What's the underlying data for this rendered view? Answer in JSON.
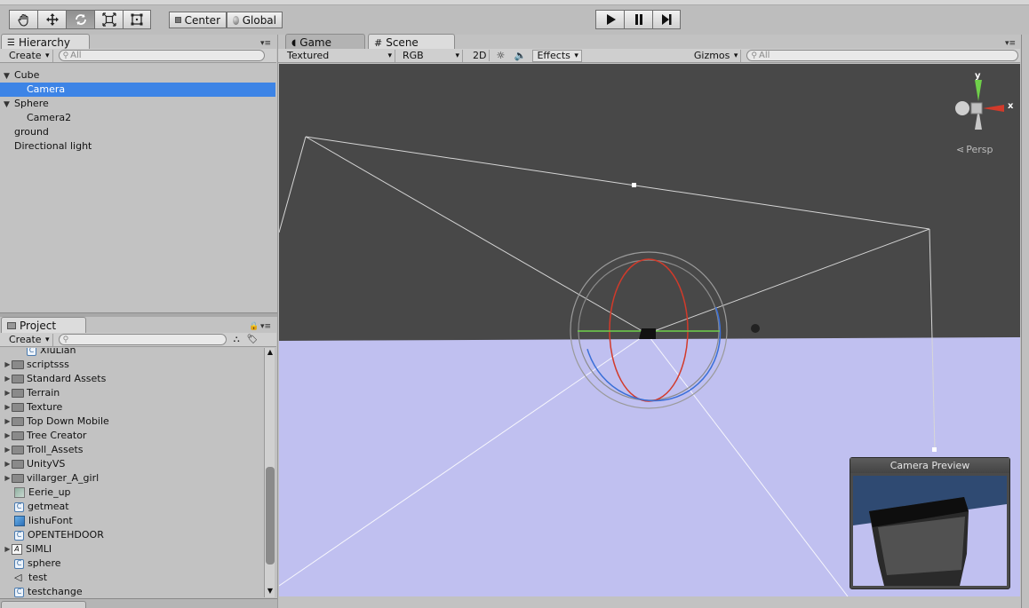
{
  "toolbar": {
    "pivot_label": "Center",
    "space_label": "Global"
  },
  "hierarchy": {
    "tab_label": "Hierarchy",
    "create_label": "Create",
    "search_placeholder": "All",
    "items": [
      {
        "label": "Cube",
        "depth": 0,
        "expanded": true
      },
      {
        "label": "Camera",
        "depth": 1,
        "selected": true
      },
      {
        "label": "Sphere",
        "depth": 0,
        "expanded": true
      },
      {
        "label": "Camera2",
        "depth": 1
      },
      {
        "label": "ground",
        "depth": 0
      },
      {
        "label": "Directional light",
        "depth": 0
      }
    ]
  },
  "project": {
    "tab_label": "Project",
    "create_label": "Create",
    "items": [
      {
        "label": "XiuLian",
        "kind": "script"
      },
      {
        "label": "scriptsss",
        "kind": "folder"
      },
      {
        "label": "Standard Assets",
        "kind": "folder"
      },
      {
        "label": "Terrain",
        "kind": "folder"
      },
      {
        "label": "Texture",
        "kind": "folder"
      },
      {
        "label": "Top Down Mobile",
        "kind": "folder"
      },
      {
        "label": "Tree Creator",
        "kind": "folder"
      },
      {
        "label": "Troll_Assets",
        "kind": "folder"
      },
      {
        "label": "UnityVS",
        "kind": "folder"
      },
      {
        "label": "villarger_A_girl",
        "kind": "folder"
      },
      {
        "label": "Eerie_up",
        "kind": "texture"
      },
      {
        "label": "getmeat",
        "kind": "script"
      },
      {
        "label": "lishuFont",
        "kind": "font"
      },
      {
        "label": "OPENTEHDOOR",
        "kind": "script"
      },
      {
        "label": "SIMLI",
        "kind": "font-folder"
      },
      {
        "label": "sphere",
        "kind": "script"
      },
      {
        "label": "test",
        "kind": "unity"
      },
      {
        "label": "testchange",
        "kind": "script"
      }
    ]
  },
  "scene_view": {
    "tabs": [
      {
        "label": "Game",
        "active": false
      },
      {
        "label": "Scene",
        "active": true
      }
    ],
    "draw_mode": "Textured",
    "render_mode": "RGB",
    "mode_2d": "2D",
    "effects_label": "Effects",
    "gizmos_label": "Gizmos",
    "search_placeholder": "All",
    "gizmo_y": "y",
    "gizmo_x": "x",
    "persp_label": "Persp",
    "camera_preview_title": "Camera Preview",
    "colors": {
      "sky": "#484848",
      "ground": "#c0c0f0",
      "selection": "#3d84e6",
      "axis_y": "#6fd04a",
      "axis_x": "#d23a2a"
    }
  }
}
